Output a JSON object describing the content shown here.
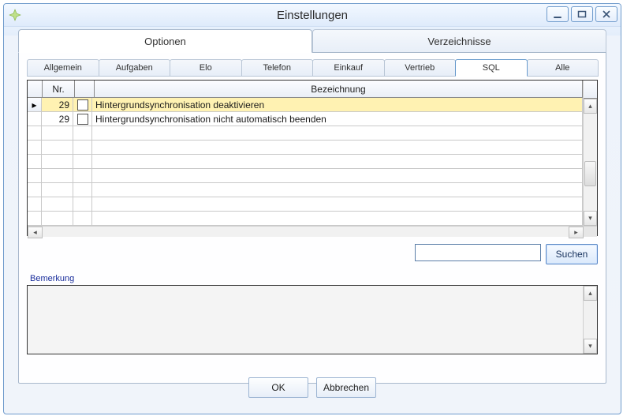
{
  "window": {
    "title": "Einstellungen"
  },
  "mainTabs": [
    {
      "label": "Optionen",
      "active": true
    },
    {
      "label": "Verzeichnisse",
      "active": false
    }
  ],
  "subTabs": [
    {
      "label": "Allgemein",
      "active": false
    },
    {
      "label": "Aufgaben",
      "active": false
    },
    {
      "label": "Elo",
      "active": false
    },
    {
      "label": "Telefon",
      "active": false
    },
    {
      "label": "Einkauf",
      "active": false
    },
    {
      "label": "Vertrieb",
      "active": false
    },
    {
      "label": "SQL",
      "active": true
    },
    {
      "label": "Alle",
      "active": false
    }
  ],
  "grid": {
    "columns": {
      "nr": "Nr.",
      "desc": "Bezeichnung"
    },
    "rows": [
      {
        "nr": "29",
        "checked": false,
        "desc": "Hintergrundsynchronisation deaktivieren",
        "selected": true
      },
      {
        "nr": "29",
        "checked": false,
        "desc": "Hintergrundsynchronisation nicht automatisch beenden",
        "selected": false
      }
    ]
  },
  "search": {
    "value": "",
    "button": "Suchen"
  },
  "bemerkung": {
    "label": "Bemerkung",
    "text": ""
  },
  "buttons": {
    "ok": "OK",
    "cancel": "Abbrechen"
  }
}
